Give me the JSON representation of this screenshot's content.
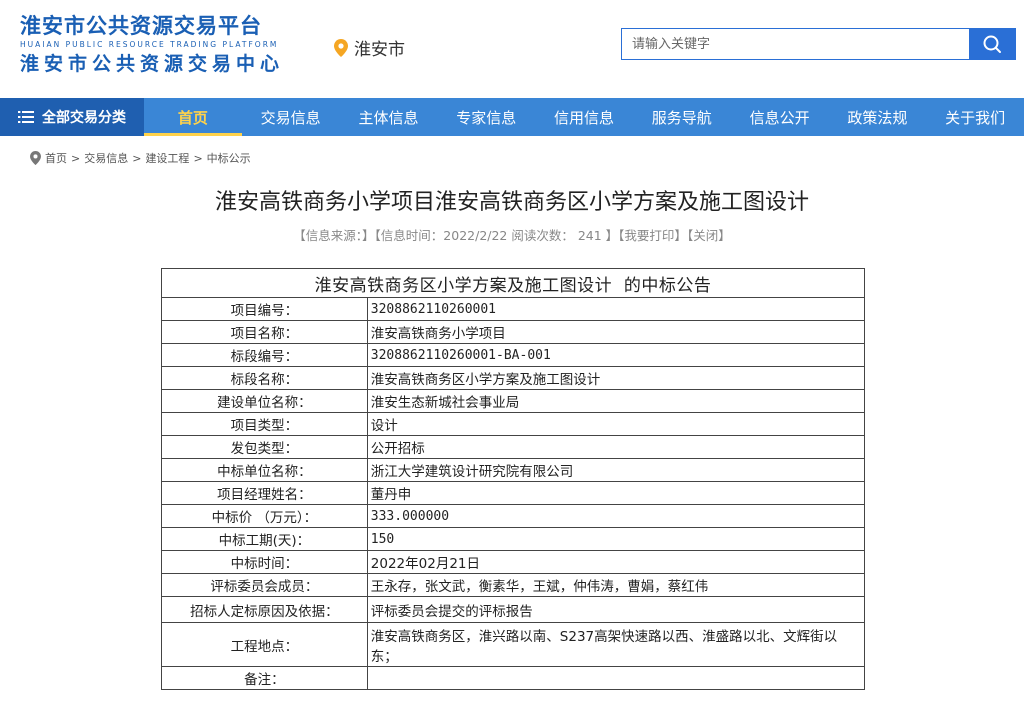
{
  "header": {
    "logo_cn": "淮安市公共资源交易平台",
    "logo_en": "HUAIAN PUBLIC RESOURCE TRADING PLATFORM",
    "logo_center": "淮安市公共资源交易中心",
    "location": "淮安市",
    "search_placeholder": "请输入关键字"
  },
  "nav": {
    "all_label": "全部交易分类",
    "items": [
      "首页",
      "交易信息",
      "主体信息",
      "专家信息",
      "信用信息",
      "服务导航",
      "信息公开",
      "政策法规",
      "关于我们"
    ]
  },
  "breadcrumb": [
    "首页",
    "交易信息",
    "建设工程",
    "中标公示"
  ],
  "article": {
    "title": "淮安高铁商务小学项目淮安高铁商务区小学方案及施工图设计",
    "meta": {
      "source": "【信息来源：】",
      "time": "【信息时间：2022/2/22 阅读次数： 241 】",
      "print": "【我要打印】",
      "close": "【关闭】"
    }
  },
  "table": {
    "heading": "淮安高铁商务区小学方案及施工图设计  的中标公告",
    "rows": [
      {
        "label": "项目编号：",
        "value": "3208862110260001"
      },
      {
        "label": "项目名称：",
        "value": "淮安高铁商务小学项目"
      },
      {
        "label": "标段编号：",
        "value": "3208862110260001-BA-001"
      },
      {
        "label": "标段名称：",
        "value": "淮安高铁商务区小学方案及施工图设计"
      },
      {
        "label": "建设单位名称：",
        "value": "淮安生态新城社会事业局"
      },
      {
        "label": "项目类型：",
        "value": "设计"
      },
      {
        "label": "发包类型：",
        "value": "公开招标"
      },
      {
        "label": "中标单位名称：",
        "value": "浙江大学建筑设计研究院有限公司"
      },
      {
        "label": "项目经理姓名：",
        "value": "董丹申"
      },
      {
        "label": "中标价 （万元）：",
        "value": "333.000000"
      },
      {
        "label": "中标工期(天)：",
        "value": "150"
      },
      {
        "label": "中标时间：",
        "value": "2022年02月21日"
      },
      {
        "label": "评标委员会成员：",
        "value": "王永存，张文武，衡素华，王斌，仲伟涛，曹娟，蔡红伟"
      },
      {
        "label": "招标人定标原因及依据：",
        "value": "评标委员会提交的评标报告"
      },
      {
        "label": "工程地点：",
        "value": "淮安高铁商务区，淮兴路以南、S237高架快速路以西、淮盛路以北、文辉街以东；"
      },
      {
        "label": "备注：",
        "value": ""
      }
    ]
  },
  "colors": {
    "brand_blue": "#1a5fb4",
    "nav_bg": "#3a86d6",
    "nav_all_bg": "#1f5fb0",
    "active_nav": "#ffd24a",
    "location_pin": "#f5a623"
  },
  "icons": [
    "location-pin-icon",
    "search-icon",
    "menu-icon",
    "breadcrumb-location-icon"
  ]
}
